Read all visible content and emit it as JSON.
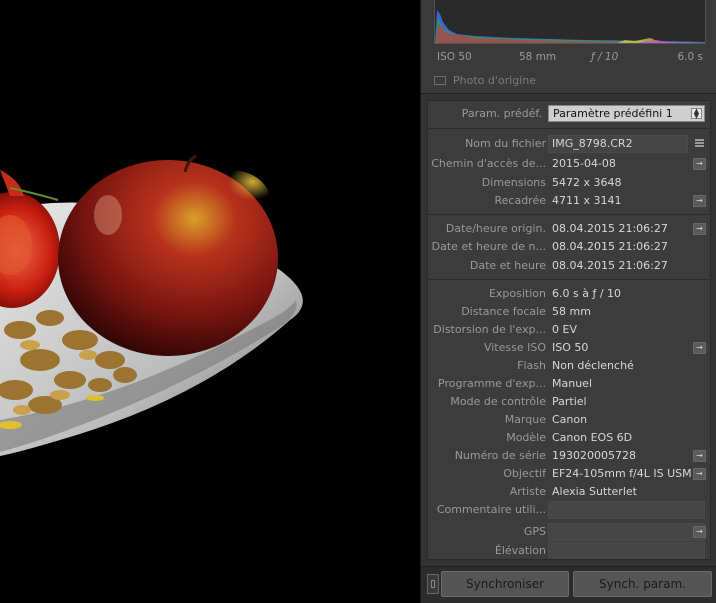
{
  "histogram": {
    "iso": "ISO 50",
    "focal": "58 mm",
    "aperture": "ƒ / 10",
    "shutter": "6.0 s",
    "original_photo_label": "Photo d'origine"
  },
  "preset": {
    "label": "Param. prédéf.",
    "value": "Paramètre prédéfini 1"
  },
  "file": {
    "filename_label": "Nom du fichier",
    "filename": "IMG_8798.CR2",
    "path_label": "Chemin d'accès de...",
    "path": "2015-04-08",
    "dimensions_label": "Dimensions",
    "dimensions": "5472 x 3648",
    "cropped_label": "Recadrée",
    "cropped": "4711 x 3141"
  },
  "dates": {
    "original_label": "Date/heure origin.",
    "original": "08.04.2015 21:06:27",
    "digitized_label": "Date et heure de n...",
    "digitized": "08.04.2015 21:06:27",
    "datetime_label": "Date et heure",
    "datetime": "08.04.2015 21:06:27"
  },
  "exif": {
    "exposure_label": "Exposition",
    "exposure": "6.0 s à ƒ / 10",
    "focal_label": "Distance focale",
    "focal": "58 mm",
    "bias_label": "Distorsion de l'exp...",
    "bias": "0 EV",
    "iso_label": "Vitesse ISO",
    "iso": "ISO 50",
    "flash_label": "Flash",
    "flash": "Non déclenché",
    "program_label": "Programme d'exp...",
    "program": "Manuel",
    "metering_label": "Mode de contrôle",
    "metering": "Partiel",
    "make_label": "Marque",
    "make": "Canon",
    "model_label": "Modèle",
    "model": "Canon EOS 6D",
    "serial_label": "Numéro de série",
    "serial": "193020005728",
    "lens_label": "Objectif",
    "lens": "EF24-105mm f/4L IS USM",
    "artist_label": "Artiste",
    "artist": "Alexia Sutterlet",
    "comment_label": "Commentaire utili...",
    "gps_label": "GPS",
    "elevation_label": "Élévation"
  },
  "buttons": {
    "sync": "Synchroniser",
    "sync_params": "Synch. param."
  }
}
